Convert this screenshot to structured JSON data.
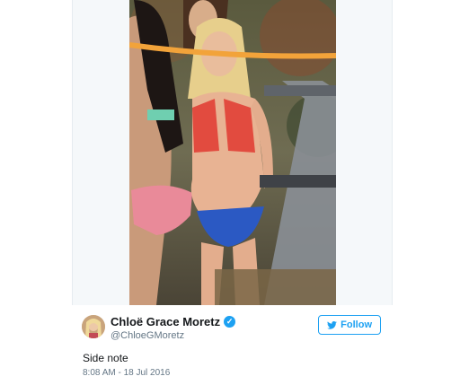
{
  "tweet": {
    "display_name": "Chloë Grace Moretz",
    "handle": "@ChloeGMoretz",
    "text": "Side note",
    "timestamp": "8:08 AM - 18 Jul 2016",
    "follow_label": "Follow",
    "verified": true
  },
  "colors": {
    "accent": "#1da1f2",
    "text": "#14171a",
    "secondary_text": "#657786"
  },
  "icons": {
    "verified": "verified-badge-icon",
    "follow": "twitter-bird-icon"
  }
}
